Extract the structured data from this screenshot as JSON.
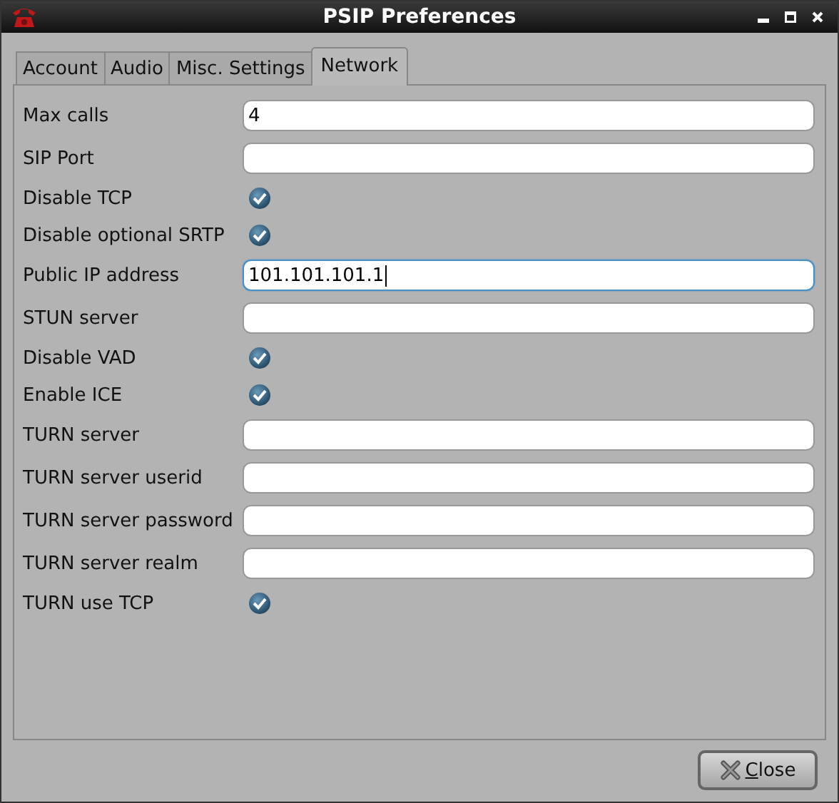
{
  "window": {
    "title": "PSIP Preferences"
  },
  "tabs": [
    {
      "label": "Account",
      "selected": false
    },
    {
      "label": "Audio",
      "selected": false
    },
    {
      "label": "Misc. Settings",
      "selected": false
    },
    {
      "label": "Network",
      "selected": true
    }
  ],
  "rows": [
    {
      "kind": "text",
      "label": "Max calls",
      "value": "4",
      "focused": false
    },
    {
      "kind": "text",
      "label": "SIP Port",
      "value": "",
      "focused": false
    },
    {
      "kind": "check",
      "label": "Disable TCP",
      "checked": true
    },
    {
      "kind": "check",
      "label": "Disable optional SRTP",
      "checked": true
    },
    {
      "kind": "text",
      "label": "Public IP address",
      "value": "101.101.101.1",
      "focused": true
    },
    {
      "kind": "text",
      "label": "STUN server",
      "value": "",
      "focused": false
    },
    {
      "kind": "check",
      "label": "Disable VAD",
      "checked": true
    },
    {
      "kind": "check",
      "label": "Enable ICE",
      "checked": true
    },
    {
      "kind": "text",
      "label": "TURN server",
      "value": "",
      "focused": false
    },
    {
      "kind": "text",
      "label": "TURN server userid",
      "value": "",
      "focused": false
    },
    {
      "kind": "text",
      "label": "TURN server password",
      "value": "",
      "focused": false
    },
    {
      "kind": "text",
      "label": "TURN server realm",
      "value": "",
      "focused": false
    },
    {
      "kind": "check",
      "label": "TURN use TCP",
      "checked": true
    }
  ],
  "buttons": [
    {
      "label": "Close"
    }
  ]
}
